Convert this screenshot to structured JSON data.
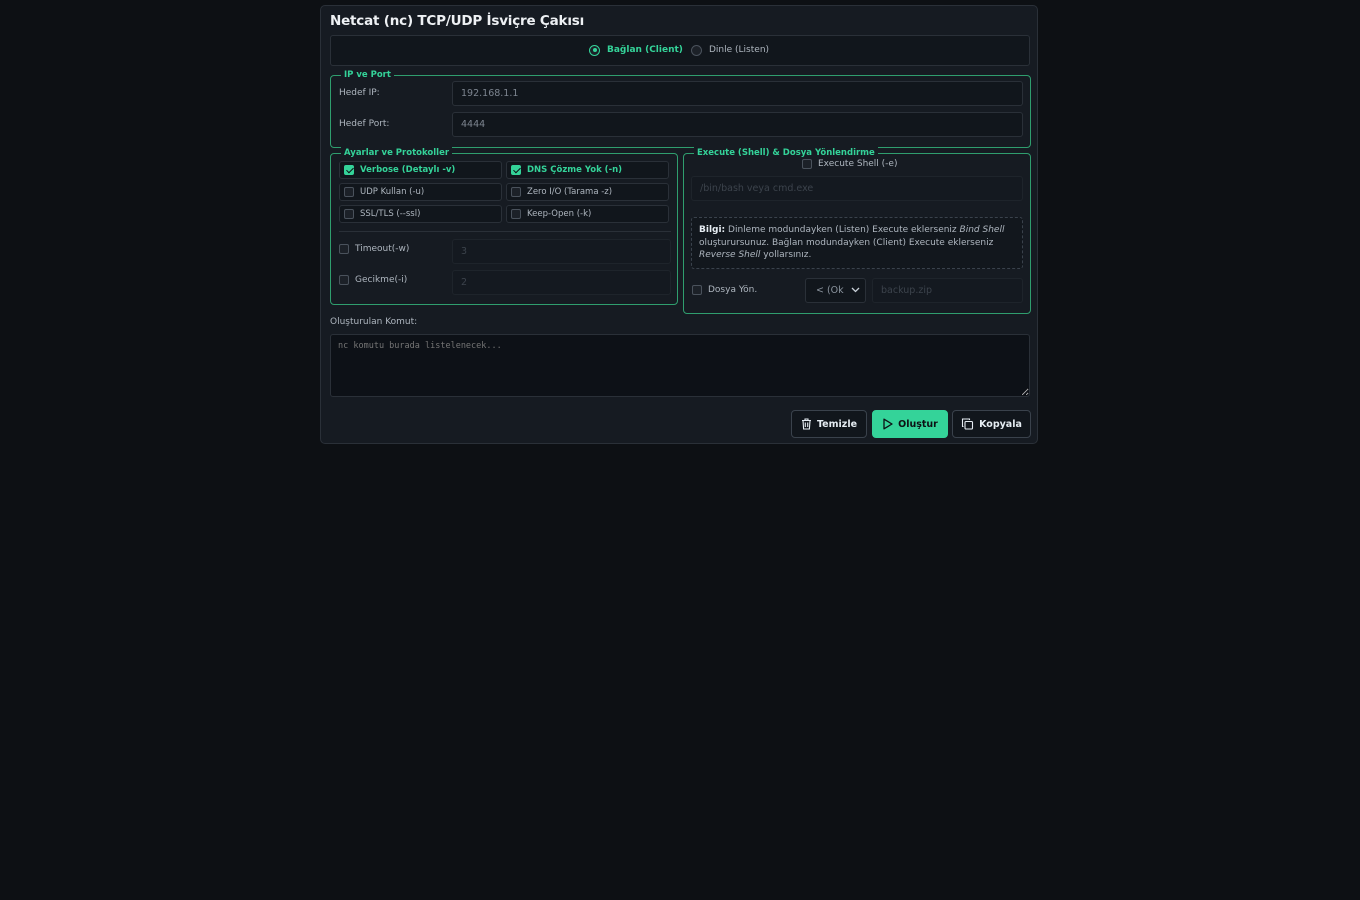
{
  "title": "Netcat (nc) TCP/UDP İsviçre Çakısı",
  "mode": {
    "client_label": "Bağlan (Client)",
    "listen_label": "Dinle (Listen)",
    "selected": "client"
  },
  "ip_port": {
    "legend": "IP ve Port",
    "ip_label": "Hedef IP:",
    "ip_value": "192.168.1.1",
    "port_label": "Hedef Port:",
    "port_value": "4444"
  },
  "settings": {
    "legend": "Ayarlar ve Protokoller",
    "options": [
      {
        "label": "Verbose (Detaylı -v)",
        "checked": true
      },
      {
        "label": "DNS Çözme Yok (-n)",
        "checked": true
      },
      {
        "label": "UDP Kullan (-u)",
        "checked": false
      },
      {
        "label": "Zero I/O (Tarama -z)",
        "checked": false
      },
      {
        "label": "SSL/TLS (--ssl)",
        "checked": false
      },
      {
        "label": "Keep-Open (-k)",
        "checked": false
      }
    ],
    "timeout_label": "Timeout(-w)",
    "timeout_placeholder": "3",
    "delay_label": "Gecikme(-i)",
    "delay_placeholder": "2"
  },
  "exec": {
    "legend": "Execute (Shell) & Dosya Yönlendirme",
    "shell_label": "Execute Shell (-e)",
    "shell_placeholder": "/bin/bash veya cmd.exe",
    "info_title": "Bilgi:",
    "info_text_1": "Dinleme modundayken (Listen) Execute eklerseniz",
    "info_em_1": "Bind Shell",
    "info_text_2": "oluşturursunuz. Bağlan modundayken (Client) Execute eklerseniz",
    "info_em_2": "Reverse Shell",
    "info_text_3": "yollarsınız.",
    "file_label": "Dosya Yön.",
    "file_select": "< (Ok",
    "file_placeholder": "backup.zip"
  },
  "command": {
    "label": "Oluşturulan Komut:",
    "placeholder": "nc komutu burada listelenecek..."
  },
  "buttons": {
    "clear": "Temizle",
    "generate": "Oluştur",
    "copy": "Kopyala"
  },
  "colors": {
    "accent": "#34d399",
    "background": "#0d1014",
    "card": "#161b22"
  }
}
